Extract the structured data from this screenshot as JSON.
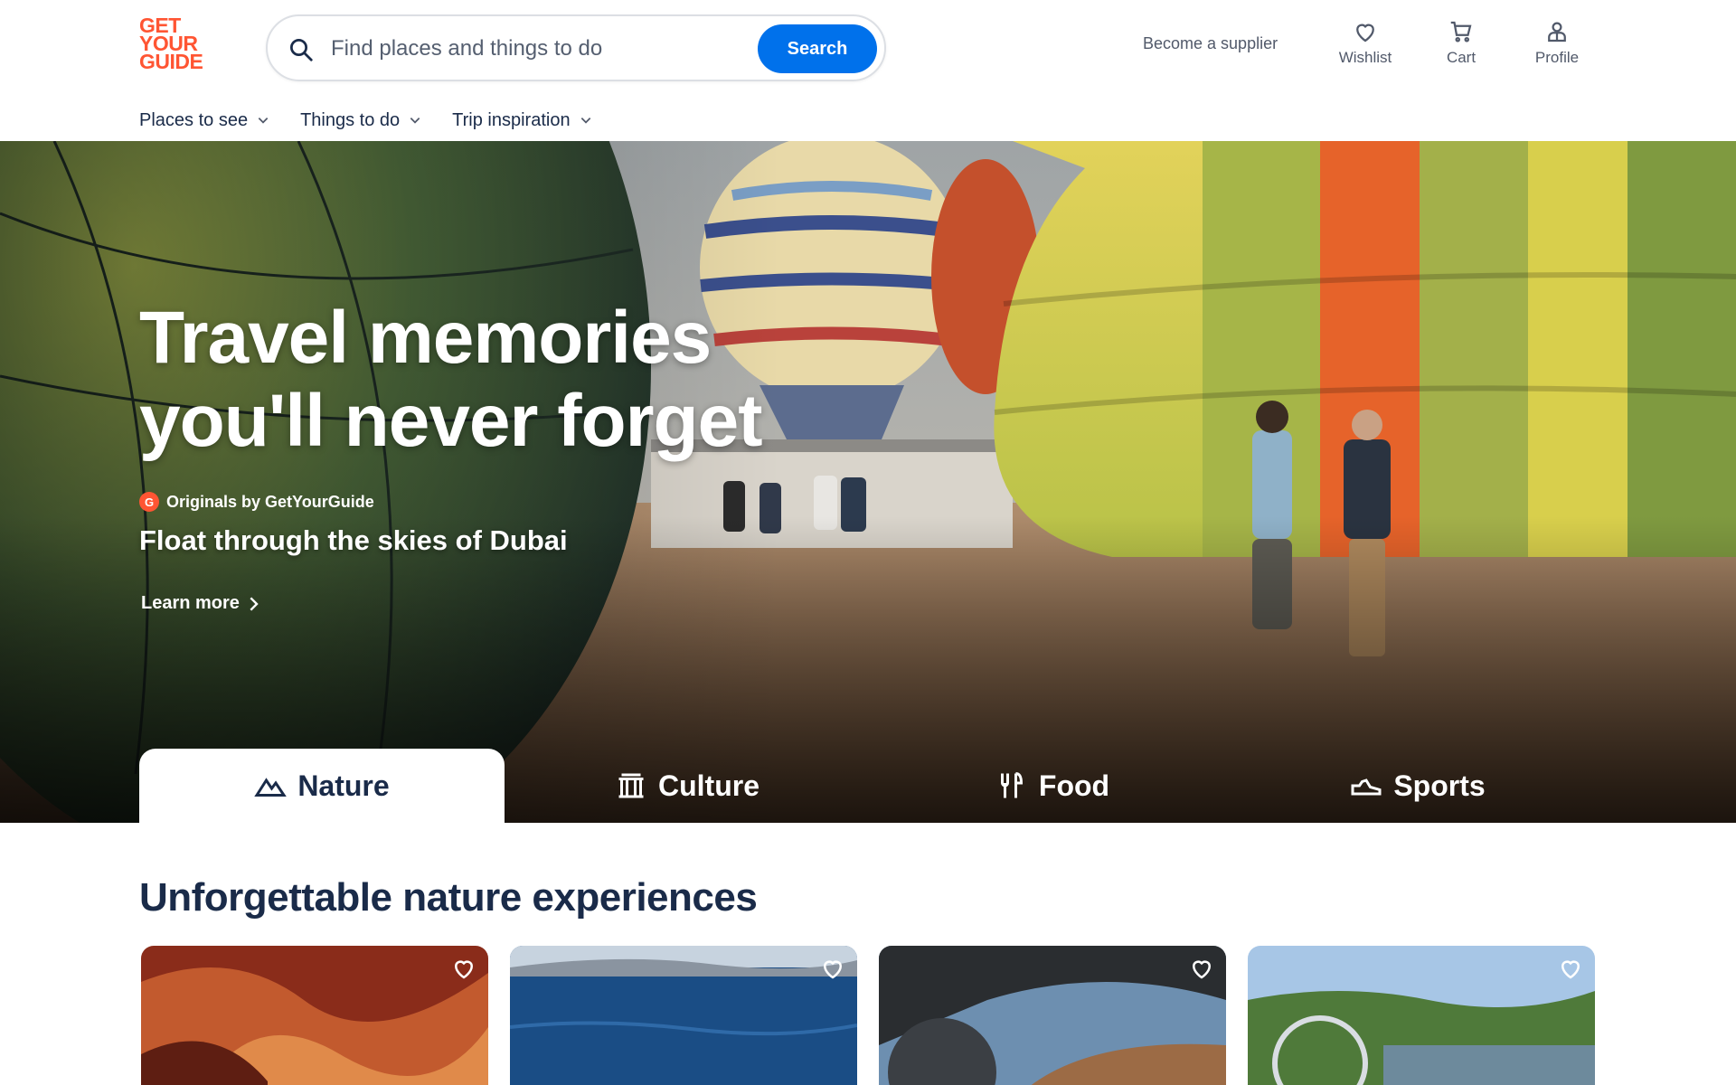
{
  "brand": {
    "logo_line1": "GET",
    "logo_line2": "YOUR",
    "logo_line3": "GUIDE",
    "color": "#ff5533"
  },
  "search": {
    "placeholder": "Find places and things to do",
    "button_label": "Search",
    "icon": "search-icon"
  },
  "header": {
    "supplier_link": "Become a supplier",
    "wishlist_label": "Wishlist",
    "cart_label": "Cart",
    "profile_label": "Profile"
  },
  "nav": [
    {
      "label": "Places to see"
    },
    {
      "label": "Things to do"
    },
    {
      "label": "Trip inspiration"
    }
  ],
  "hero": {
    "title_line1": "Travel memories",
    "title_line2": "you'll never forget",
    "originals_badge": "G",
    "originals_label": "Originals by GetYourGuide",
    "subtitle": "Float through the skies of Dubai",
    "learn_more": "Learn more"
  },
  "tabs": [
    {
      "label": "Nature",
      "icon": "mountain-icon",
      "active": true
    },
    {
      "label": "Culture",
      "icon": "temple-icon",
      "active": false
    },
    {
      "label": "Food",
      "icon": "fork-knife-icon",
      "active": false
    },
    {
      "label": "Sports",
      "icon": "sneaker-icon",
      "active": false
    }
  ],
  "section": {
    "title": "Unforgettable nature experiences"
  },
  "colors": {
    "accent": "#0071eb",
    "text_dark": "#1a2b49",
    "brand": "#ff5533"
  }
}
